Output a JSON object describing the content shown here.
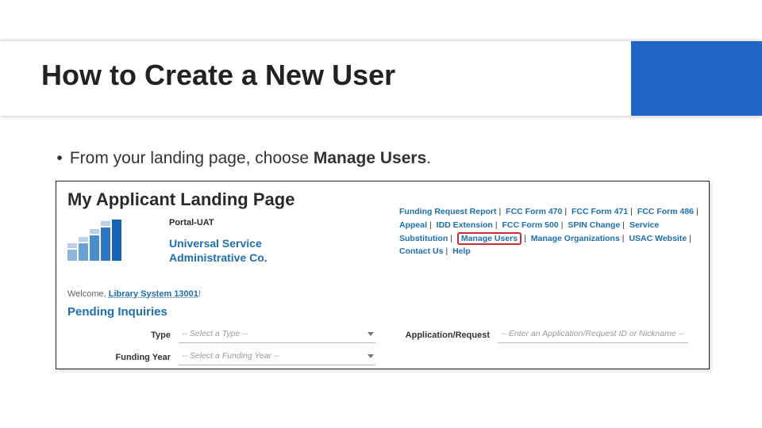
{
  "slide": {
    "title": "How to Create a New User",
    "bullet_prefix": "From your landing page, choose ",
    "bullet_strong": "Manage Users",
    "bullet_suffix": "."
  },
  "shot": {
    "page_title": "My Applicant Landing Page",
    "portal_label": "Portal-UAT",
    "company_line1": "Universal Service",
    "company_line2": "Administrative Co.",
    "welcome_prefix": "Welcome, ",
    "welcome_link": "Library System 13001",
    "welcome_suffix": "!",
    "pending_heading": "Pending Inquiries",
    "links": {
      "funding_request_report": "Funding Request Report",
      "fcc_470": "FCC Form 470",
      "fcc_471": "FCC Form 471",
      "fcc_486": "FCC Form 486",
      "appeal": "Appeal",
      "idd_extension": "IDD Extension",
      "fcc_500": "FCC Form 500",
      "spin_change": "SPIN Change",
      "service_substitution": "Service Substitution",
      "manage_users": "Manage Users",
      "manage_orgs": "Manage Organizations",
      "usac_website": "USAC Website",
      "contact_us": "Contact Us",
      "help": "Help"
    },
    "form": {
      "type_label": "Type",
      "type_placeholder": "-- Select a Type --",
      "fy_label": "Funding Year",
      "fy_placeholder": "-- Select a Funding Year --",
      "app_label": "Application/Request",
      "app_placeholder": "-- Enter an Application/Request ID or Nickname --"
    }
  }
}
